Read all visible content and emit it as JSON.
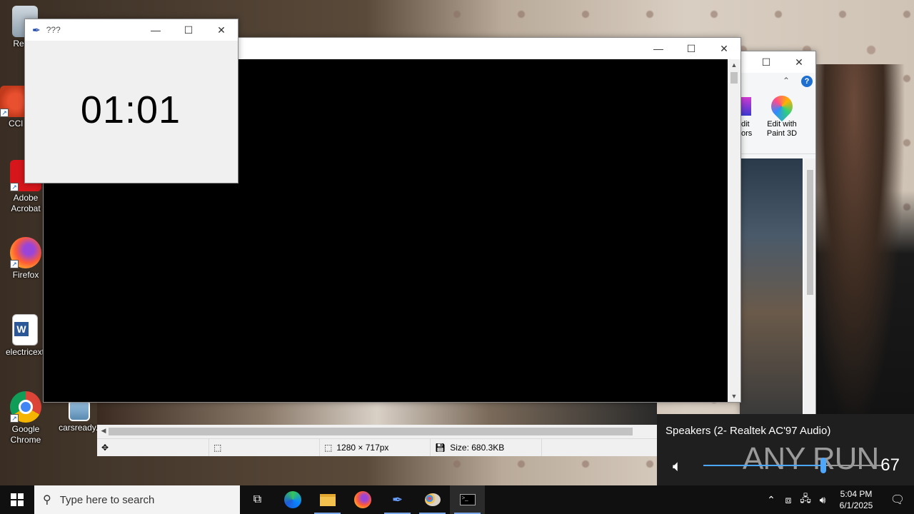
{
  "desktop": {
    "icons": [
      {
        "label": "Recyc",
        "icon": "recycle-bin-icon"
      },
      {
        "label": "CCl",
        "icon": "ccleaner-icon"
      },
      {
        "label": "Adobe Acrobat",
        "icon": "adobe-acrobat-icon"
      },
      {
        "label": "Firefox",
        "icon": "firefox-icon"
      },
      {
        "label": "electricext",
        "icon": "word-document-icon"
      },
      {
        "label": "Google Chrome",
        "icon": "chrome-icon"
      },
      {
        "label": "carsready.j",
        "icon": "image-file-icon"
      }
    ]
  },
  "timer_window": {
    "title": "???",
    "display": "01:01"
  },
  "viewer_window": {
    "title": ""
  },
  "paint_window": {
    "ribbon": {
      "edit_colors_label": "dit\nors",
      "paint3d_label": "Edit with Paint 3D"
    },
    "status": {
      "dimensions": "1280 × 717px",
      "size": "Size: 680.3KB"
    }
  },
  "volume_flyout": {
    "device": "Speakers (2- Realtek AC'97 Audio)",
    "level": 67,
    "watermark": "ANY RUN"
  },
  "taskbar": {
    "search_placeholder": "Type here to search",
    "apps": [
      "task-view",
      "edge",
      "file-explorer",
      "firefox",
      "feather-app",
      "paint",
      "terminal"
    ],
    "time": "5:04 PM",
    "date": "6/1/2025"
  },
  "colors": {
    "accent": "#4ea7ff",
    "taskbar": "#101010",
    "flyout": "#1f1f1f"
  }
}
